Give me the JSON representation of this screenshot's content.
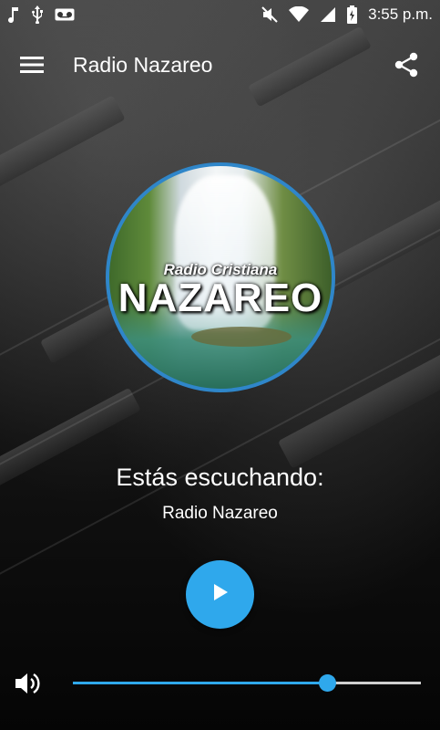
{
  "status_bar": {
    "time": "3:55 p.m.",
    "icons": [
      "music-note-icon",
      "usb-icon",
      "voicemail-icon",
      "mute-icon",
      "wifi-icon",
      "signal-icon",
      "battery-charging-icon"
    ]
  },
  "toolbar": {
    "title": "Radio Nazareo",
    "menu_icon": "hamburger-menu-icon",
    "share_icon": "share-icon"
  },
  "logo": {
    "brand_top": "Radio Cristiana",
    "brand_main": "NAZAREO"
  },
  "now_playing": {
    "label": "Estás escuchando:",
    "station": "Radio Nazareo"
  },
  "player": {
    "play_icon": "play-icon"
  },
  "volume": {
    "icon": "volume-icon",
    "level": 0.73
  },
  "colors": {
    "accent": "#2fa8ec",
    "logo_border": "#2f86c9"
  }
}
